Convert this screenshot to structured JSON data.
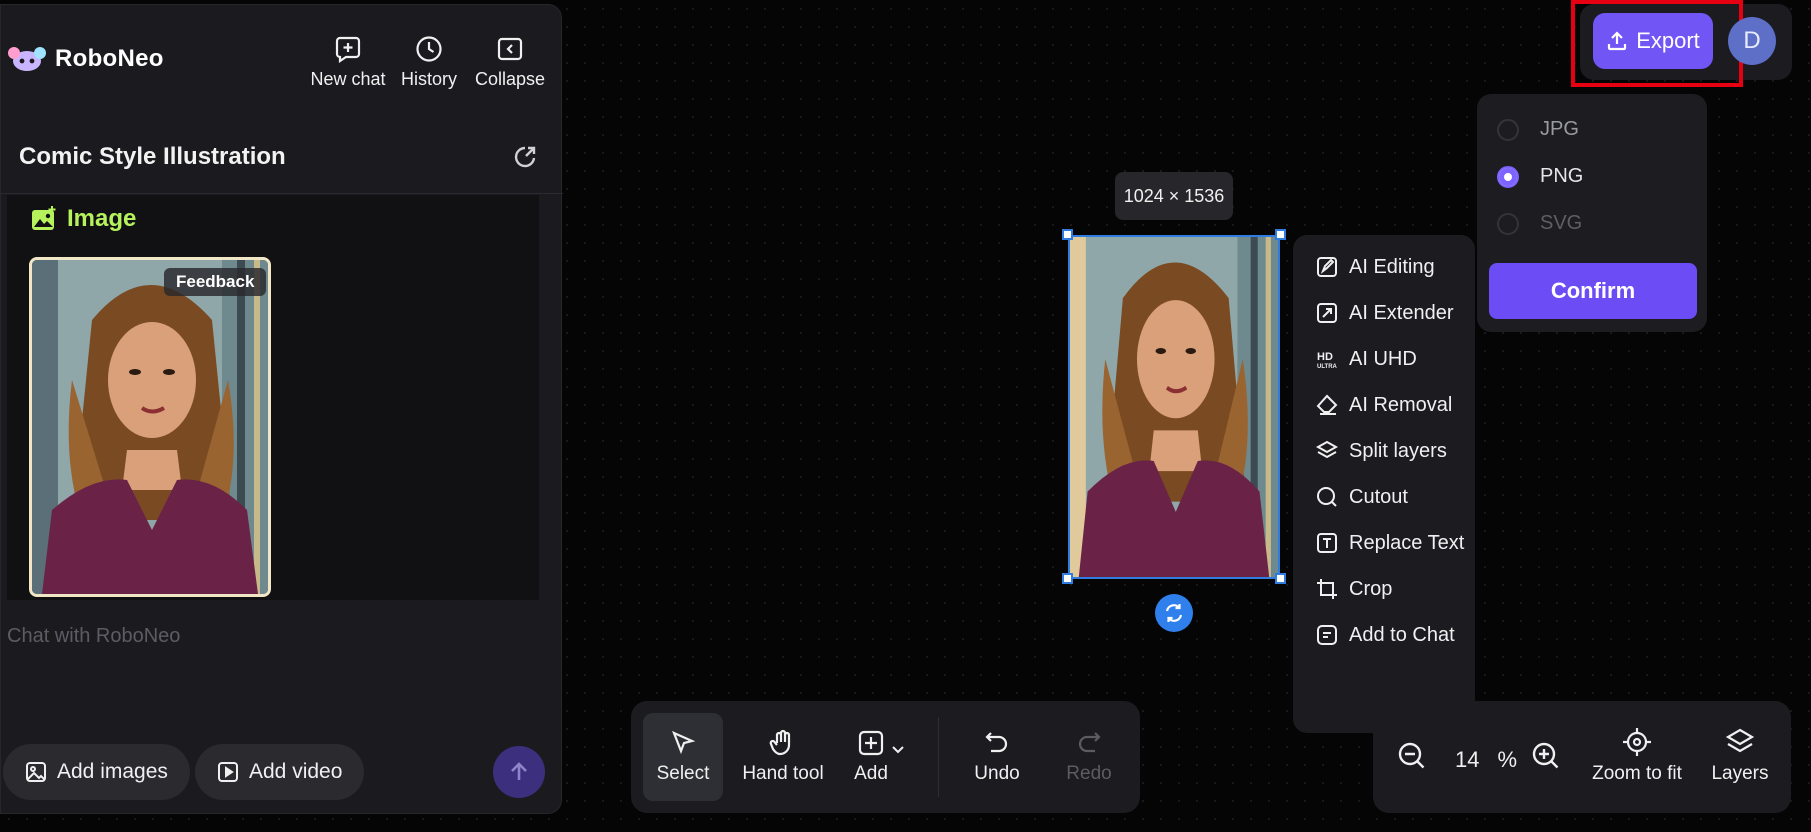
{
  "sidebar": {
    "brand": "RoboNeo",
    "actions": {
      "new_chat": "New chat",
      "history": "History",
      "collapse": "Collapse"
    },
    "chat_title": "Comic Style Illustration",
    "message": {
      "heading": "Image",
      "feedback": "Feedback"
    },
    "input_placeholder": "Chat with RoboNeo",
    "add_images": "Add images",
    "add_video": "Add video"
  },
  "header": {
    "export_label": "Export",
    "avatar_initial": "D"
  },
  "export_panel": {
    "formats": [
      {
        "label": "JPG",
        "selected": false
      },
      {
        "label": "PNG",
        "selected": true
      },
      {
        "label": "SVG",
        "selected": false
      }
    ],
    "confirm_label": "Confirm"
  },
  "canvas": {
    "dimensions": "1024 × 1536"
  },
  "context_menu": {
    "items": [
      "AI Editing",
      "AI Extender",
      "AI UHD",
      "AI Removal",
      "Split layers",
      "Cutout",
      "Replace Text",
      "Crop",
      "Add to Chat"
    ]
  },
  "toolbar": {
    "select": "Select",
    "hand_tool": "Hand tool",
    "add": "Add",
    "undo": "Undo",
    "redo": "Redo"
  },
  "zoom": {
    "value": "14",
    "unit": "%",
    "zoom_to_fit": "Zoom to fit",
    "layers": "Layers"
  },
  "colors": {
    "accent": "#7156f5",
    "highlight": "#e60012",
    "image_label": "#b5f25b",
    "selection": "#2f7de0"
  }
}
